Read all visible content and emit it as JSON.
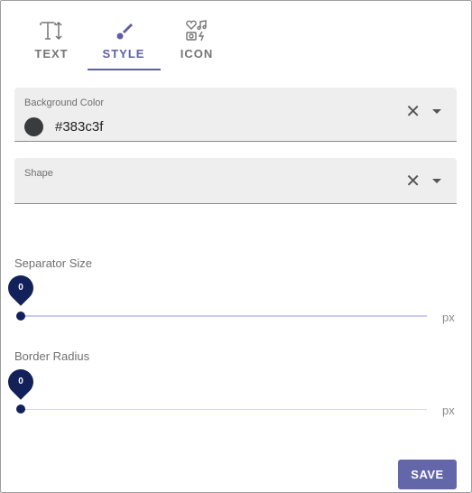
{
  "tabs": [
    {
      "label": "TEXT",
      "icon": "text-size-icon"
    },
    {
      "label": "STYLE",
      "icon": "brush-icon",
      "active": true
    },
    {
      "label": "ICON",
      "icon": "icons-icon"
    }
  ],
  "background_color": {
    "label": "Background Color",
    "value": "#383c3f"
  },
  "shape": {
    "label": "Shape",
    "value": ""
  },
  "separator_size": {
    "label": "Separator Size",
    "value": "0",
    "unit": "px"
  },
  "border_radius": {
    "label": "Border Radius",
    "value": "0",
    "unit": "px"
  },
  "save_label": "SAVE",
  "colors": {
    "accent": "#5c5fa6",
    "slider": "#13215a",
    "button": "#6366a8"
  }
}
